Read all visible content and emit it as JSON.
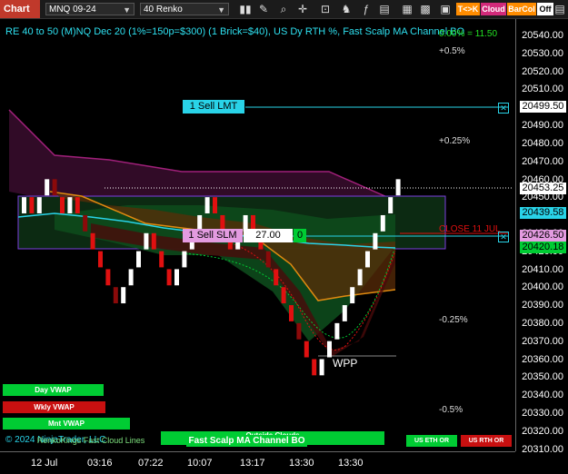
{
  "toolbar": {
    "title": "Chart",
    "instrument": "MNQ 09-24",
    "period": "40 Renko",
    "btn_tk": "T<>K",
    "btn_cloud": "Cloud",
    "btn_barcol": "BarCol",
    "btn_off": "Off"
  },
  "legend": "RE 40 to 50 (M)NQ Dec 20 (1%=150p=$300) (1 Brick=$40), US Dy RTH %, Fast Scalp MA Channel BO",
  "pct_labels": [
    "+0.5%",
    "+0.25%",
    "-0.25%",
    "-0.5%"
  ],
  "top_pct_readout": "0.00% = 11.50",
  "orders": {
    "sell_lmt": "1 Sell LMT",
    "sell_slm": "1 Sell SLM",
    "slm_qty": "27.00",
    "slm_flag": "0",
    "sell_lmt_price": "20499.50",
    "sell_slm_price": "20426.50"
  },
  "close_label": "CLOSE 11 JUL",
  "wpp_label": "WPP",
  "price_axis": {
    "ticks": [
      "20540.00",
      "20530.00",
      "20520.00",
      "20510.00",
      "20500.00",
      "20490.00",
      "20480.00",
      "20470.00",
      "20460.00",
      "20450.00",
      "20440.00",
      "20430.00",
      "20420.00",
      "20410.00",
      "20400.00",
      "20390.00",
      "20380.00",
      "20370.00",
      "20360.00",
      "20350.00",
      "20340.00",
      "20330.00",
      "20320.00",
      "20310.00"
    ],
    "last_price": "20453.25",
    "cyan_marker": "20439.58",
    "green_marker": "20420.18"
  },
  "time_axis": [
    "12 Jul",
    "03:16",
    "07:22",
    "10:07",
    "13:17",
    "13:30",
    "13:30"
  ],
  "buttons": {
    "day_vwap": "Day VWAP",
    "wkly_vwap": "Wkly VWAP",
    "mnt_vwap": "Mnt VWAP",
    "copyright": "© 2024 NinjaTrader, LLC",
    "renko_kings": "RenkoKings Fast Cloud Lines",
    "outside_clouds": "Outside Clouds",
    "fast_scalp": "Fast Scalp MA Channel BO",
    "us_eth_or": "US ETH OR",
    "us_rth_or": "US RTH OR"
  },
  "colors": {
    "up_bar": "#ffffff",
    "down_bar": "#e01010",
    "down_bar_dark": "#8b0a0a",
    "cyan": "#29d3e8",
    "green": "#00cc33",
    "magenta": "#a0207a",
    "orange": "#e08a10"
  },
  "chart_data": {
    "type": "renko",
    "brick_size": 10,
    "opens_closes": [
      [
        20430,
        20440
      ],
      [
        20440,
        20430
      ],
      [
        20430,
        20440
      ],
      [
        20440,
        20450
      ],
      [
        20450,
        20440
      ],
      [
        20440,
        20430
      ],
      [
        20430,
        20440
      ],
      [
        20440,
        20430
      ],
      [
        20430,
        20420
      ],
      [
        20420,
        20410
      ],
      [
        20410,
        20400
      ],
      [
        20400,
        20390
      ],
      [
        20390,
        20380
      ],
      [
        20380,
        20390
      ],
      [
        20390,
        20400
      ],
      [
        20400,
        20410
      ],
      [
        20410,
        20420
      ],
      [
        20420,
        20410
      ],
      [
        20410,
        20400
      ],
      [
        20400,
        20390
      ],
      [
        20390,
        20400
      ],
      [
        20400,
        20410
      ],
      [
        20410,
        20420
      ],
      [
        20420,
        20430
      ],
      [
        20430,
        20440
      ],
      [
        20440,
        20430
      ],
      [
        20430,
        20420
      ],
      [
        20420,
        20410
      ],
      [
        20410,
        20420
      ],
      [
        20420,
        20430
      ],
      [
        20430,
        20420
      ],
      [
        20420,
        20410
      ],
      [
        20410,
        20400
      ],
      [
        20400,
        20390
      ],
      [
        20390,
        20380
      ],
      [
        20380,
        20370
      ],
      [
        20370,
        20360
      ],
      [
        20360,
        20350
      ],
      [
        20350,
        20340
      ],
      [
        20340,
        20350
      ],
      [
        20350,
        20360
      ],
      [
        20360,
        20370
      ],
      [
        20370,
        20380
      ],
      [
        20380,
        20390
      ],
      [
        20390,
        20400
      ],
      [
        20400,
        20410
      ],
      [
        20410,
        20420
      ],
      [
        20420,
        20430
      ],
      [
        20430,
        20440
      ],
      [
        20440,
        20450
      ]
    ]
  }
}
